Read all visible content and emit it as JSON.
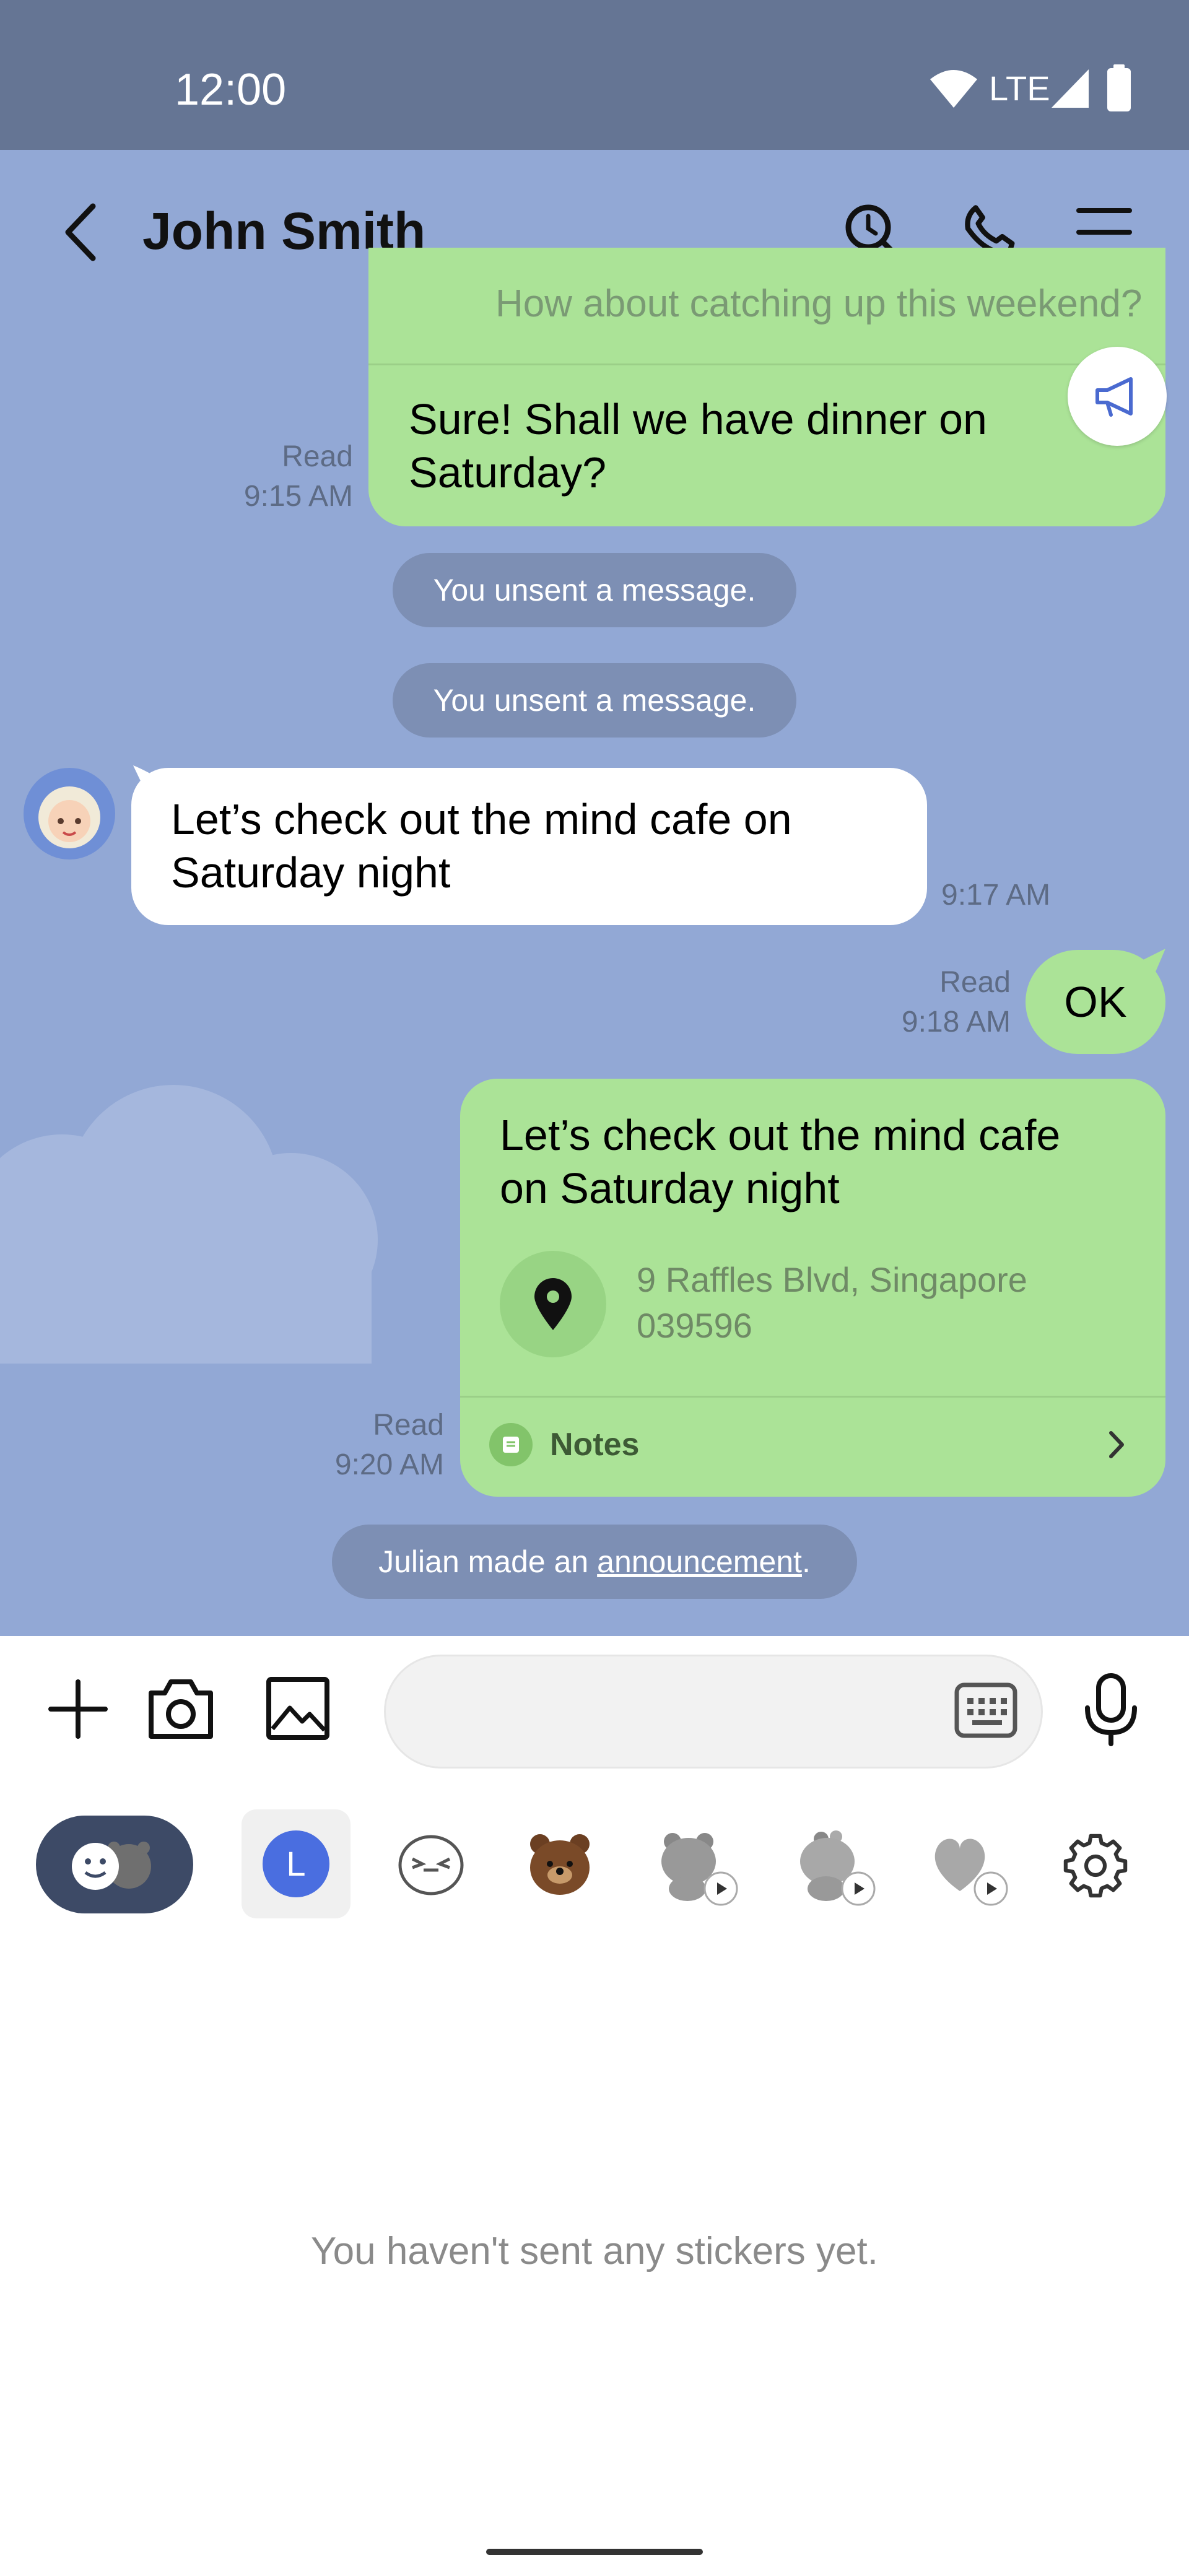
{
  "status": {
    "time": "12:00",
    "network": "LTE"
  },
  "header": {
    "title": "John Smith"
  },
  "messages": {
    "partial_text": "How about catching up this weekend?",
    "m1_text": "Sure! Shall we have dinner on Saturday?",
    "m1_line1": "Sure! Shall we have dinner on",
    "m1_line2": "Saturday?",
    "m1_read": "Read",
    "m1_time": "9:15 AM",
    "unsent1": "You unsent a message.",
    "unsent2": "You unsent a message.",
    "m2_line1": "Let’s check out the mind cafe on",
    "m2_line2": "Saturday night",
    "m2_time": "9:17 AM",
    "m3_text": "OK",
    "m3_read": "Read",
    "m3_time": "9:18 AM",
    "m4_line1": "Let’s check out the mind cafe",
    "m4_line2": "on Saturday night",
    "m4_address_line1": "9 Raffles Blvd, Singapore",
    "m4_address_line2": "039596",
    "m4_notes": "Notes",
    "m4_read": "Read",
    "m4_time": "9:20 AM",
    "announce_prefix": "Julian made an ",
    "announce_link": "announcement",
    "announce_suffix": "."
  },
  "sticker_panel": {
    "empty_text": "You haven't sent any stickers yet.",
    "recent_tab_letter": "L"
  },
  "colors": {
    "status_bar": "#657594",
    "chat_bg": "#92a8d5",
    "my_bubble": "#abe397",
    "their_bubble": "#ffffff",
    "system_pill": "#7d8fb4"
  },
  "icons": [
    "back-icon",
    "search-icon",
    "phone-icon",
    "menu-icon",
    "megaphone-icon",
    "location-pin-icon",
    "notes-icon",
    "chevron-right-icon",
    "plus-icon",
    "camera-icon",
    "image-icon",
    "keyboard-icon",
    "microphone-icon",
    "emoji-toggle-icon",
    "settings-icon"
  ]
}
